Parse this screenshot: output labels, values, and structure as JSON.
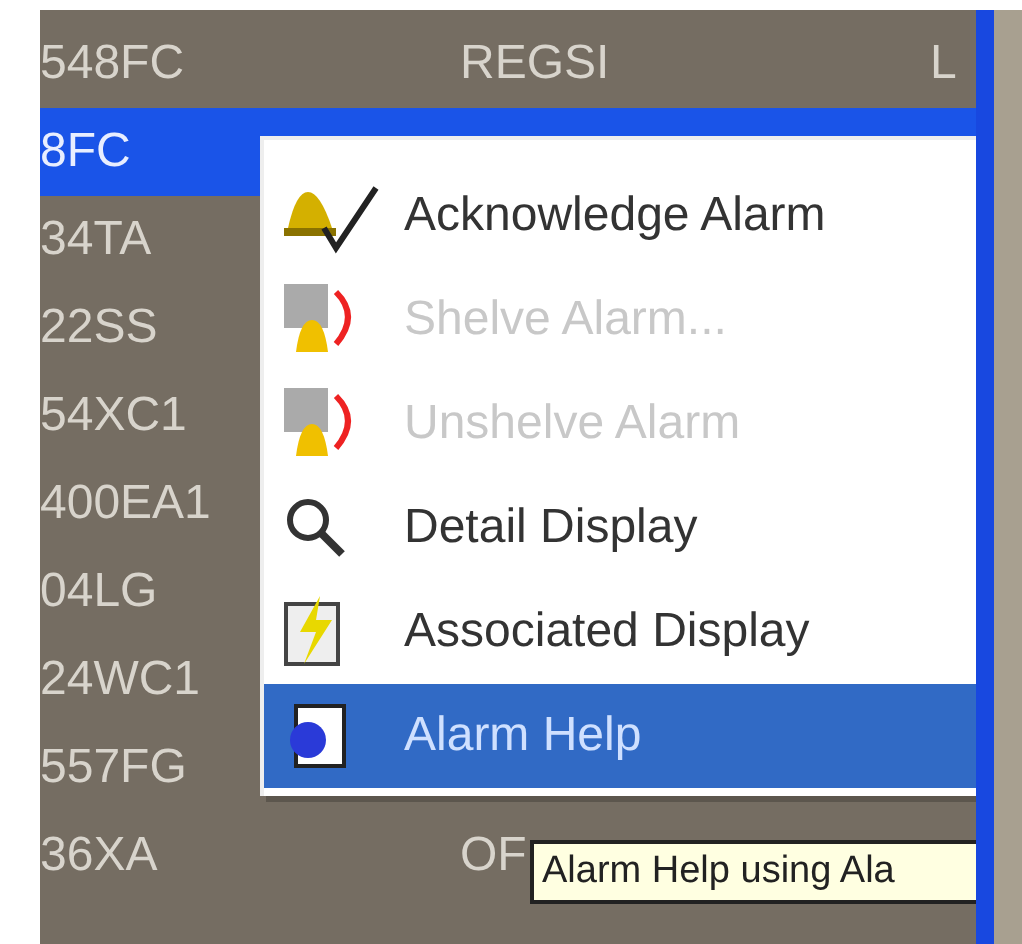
{
  "table": {
    "rows": [
      {
        "column_1": "548FC",
        "column_2": "REGSI",
        "column_3": "L",
        "selected": false
      },
      {
        "column_1": "8FC",
        "selected": true
      },
      {
        "column_1": "34TA",
        "selected": false
      },
      {
        "column_1": "22SS",
        "selected": false
      },
      {
        "column_1": "54XC1",
        "selected": false
      },
      {
        "column_1": "400EA1",
        "selected": false
      },
      {
        "column_1": "04LG",
        "selected": false
      },
      {
        "column_1": "24WC1",
        "selected": false
      },
      {
        "column_1": "557FG",
        "selected": false
      },
      {
        "column_1": "36XA",
        "column_2": "OF",
        "selected": false
      }
    ]
  },
  "context_menu": {
    "items": [
      {
        "kind": "acknowledge",
        "label": "Acknowledge Alarm",
        "disabled": false,
        "selected": false
      },
      {
        "kind": "shelve",
        "label": "Shelve Alarm...",
        "disabled": true,
        "selected": false
      },
      {
        "kind": "shelve",
        "label": "Unshelve Alarm",
        "disabled": true,
        "selected": false
      },
      {
        "kind": "detail",
        "label": "Detail Display",
        "disabled": false,
        "selected": false
      },
      {
        "kind": "associated",
        "label": "Associated Display",
        "disabled": false,
        "selected": false
      },
      {
        "kind": "help",
        "label": "Alarm Help",
        "disabled": false,
        "selected": true
      }
    ]
  },
  "tooltip": {
    "text": "Alarm Help using Ala"
  }
}
